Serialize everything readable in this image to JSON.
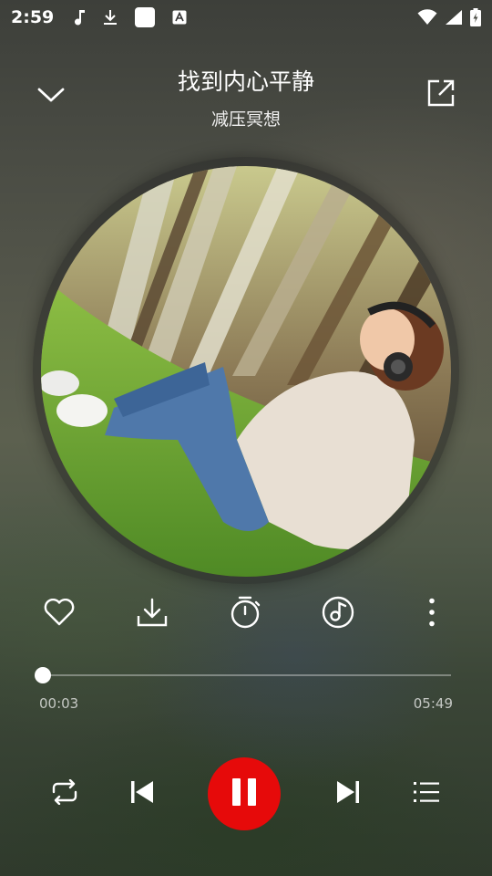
{
  "status_bar": {
    "time": "2:59",
    "left_icons": [
      "music-note-icon",
      "download-icon",
      "app-square-icon",
      "font-a-icon"
    ],
    "right_icons": [
      "wifi-icon",
      "signal-icon",
      "battery-charging-icon"
    ]
  },
  "header": {
    "title": "找到内心平静",
    "subtitle": "减压冥想",
    "collapse_icon": "chevron-down-icon",
    "share_icon": "share-external-icon"
  },
  "album": {
    "image": "woman-with-headphones-relaxing-on-grass-photo"
  },
  "actions": [
    {
      "icon": "heart-icon"
    },
    {
      "icon": "download-icon"
    },
    {
      "icon": "timer-icon"
    },
    {
      "icon": "music-disc-icon"
    },
    {
      "icon": "more-vertical-icon"
    }
  ],
  "progress": {
    "current": "00:03",
    "total": "05:49",
    "fraction": 0.009
  },
  "controls": {
    "repeat_icon": "repeat-icon",
    "previous_icon": "skip-previous-icon",
    "pause_icon": "pause-icon",
    "next_icon": "skip-next-icon",
    "playlist_icon": "playlist-icon"
  },
  "colors": {
    "accent": "#e60a0a",
    "text": "#ffffff"
  }
}
